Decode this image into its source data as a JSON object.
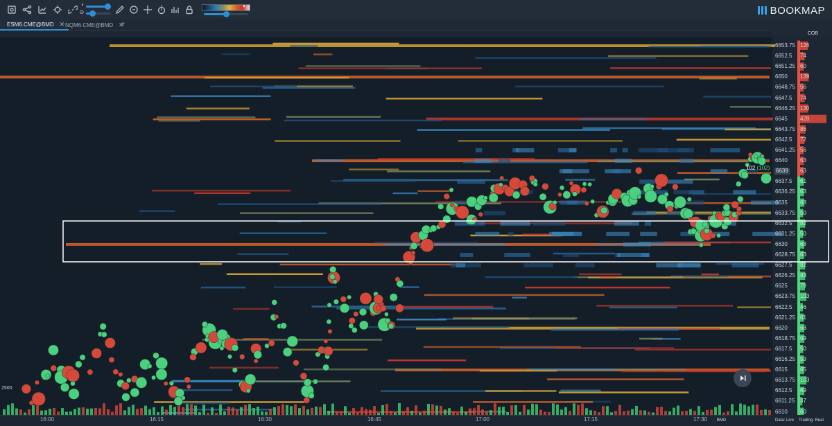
{
  "app": {
    "brand": "BOOKMAP",
    "colors": {
      "background": "#1c2733",
      "accent": "#2e8fd6",
      "ask": "#d8483a",
      "bid": "#3fcf72",
      "highlight_box": "#ffffff"
    }
  },
  "toolbar": {
    "icons": [
      "screenshot-icon",
      "share-icon",
      "chart-icon",
      "crosshair-icon",
      "link-icon",
      "opacity-icon",
      "pencil-icon",
      "chat-icon",
      "move-icon",
      "stopwatch-icon",
      "indicators-icon",
      "lock-icon"
    ],
    "slider_top_level": 0.85,
    "slider_bottom_level": 0.25,
    "heatmap_slider_level": 0.5,
    "dropdown_arrow": "▾"
  },
  "tabs": [
    {
      "label": "ESM6.CME@BMD",
      "close": "✕",
      "active": true
    },
    {
      "label": "NQM6.CME@BMD",
      "close": "✕",
      "active": false
    }
  ],
  "add_tab": "+",
  "cob_header": "COB",
  "price_levels": [
    {
      "price": "6653.75",
      "cob": "126",
      "side": "ask"
    },
    {
      "price": "6652.5",
      "cob": "74",
      "side": "ask"
    },
    {
      "price": "6651.25",
      "cob": "60",
      "side": "ask"
    },
    {
      "price": "6650",
      "cob": "139",
      "side": "ask"
    },
    {
      "price": "6648.75",
      "cob": "56",
      "side": "ask"
    },
    {
      "price": "6647.5",
      "cob": "74",
      "side": "ask"
    },
    {
      "price": "6646.25",
      "cob": "130",
      "side": "ask"
    },
    {
      "price": "6645",
      "cob": "428",
      "side": "ask"
    },
    {
      "price": "6643.75",
      "cob": "86",
      "side": "ask"
    },
    {
      "price": "6642.5",
      "cob": "72",
      "side": "ask"
    },
    {
      "price": "6641.25",
      "cob": "56",
      "side": "ask"
    },
    {
      "price": "6640",
      "cob": "63",
      "side": "ask"
    },
    {
      "price": "6639",
      "cob": "63",
      "side": "ask"
    },
    {
      "price": "6637.5",
      "cob": "61",
      "side": "bid"
    },
    {
      "price": "6636.25",
      "cob": "63",
      "side": "bid"
    },
    {
      "price": "6635",
      "cob": "68",
      "side": "bid"
    },
    {
      "price": "6633.75",
      "cob": "50",
      "side": "bid"
    },
    {
      "price": "6632.5",
      "cob": "82",
      "side": "bid"
    },
    {
      "price": "6631.25",
      "cob": "50",
      "side": "bid"
    },
    {
      "price": "6630",
      "cob": "68",
      "side": "bid"
    },
    {
      "price": "6628.75",
      "cob": "63",
      "side": "bid"
    },
    {
      "price": "6627.5",
      "cob": "82",
      "side": "bid"
    },
    {
      "price": "6626.25",
      "cob": "83",
      "side": "bid"
    },
    {
      "price": "6625",
      "cob": "79",
      "side": "bid"
    },
    {
      "price": "6623.75",
      "cob": "103",
      "side": "bid"
    },
    {
      "price": "6622.5",
      "cob": "46",
      "side": "bid"
    },
    {
      "price": "6621.25",
      "cob": "61",
      "side": "bid"
    },
    {
      "price": "6620",
      "cob": "68",
      "side": "bid"
    },
    {
      "price": "6618.75",
      "cob": "69",
      "side": "bid"
    },
    {
      "price": "6617.5",
      "cob": "50",
      "side": "bid"
    },
    {
      "price": "6616.25",
      "cob": "59",
      "side": "bid"
    },
    {
      "price": "6615",
      "cob": "65",
      "side": "bid"
    },
    {
      "price": "6613.75",
      "cob": "103",
      "side": "bid"
    },
    {
      "price": "6612.5",
      "cob": "69",
      "side": "bid"
    },
    {
      "price": "6611.25",
      "cob": "37",
      "side": "bid"
    },
    {
      "price": "6610",
      "cob": "60",
      "side": "bid"
    }
  ],
  "current_price": "6639",
  "last_trade": {
    "size": "102",
    "aggregate": "(102)"
  },
  "time_axis": [
    "16:00",
    "16:15",
    "16:30",
    "16:45",
    "17:00",
    "17:15",
    "17:30"
  ],
  "left_axis_label": "2500",
  "footer": {
    "bmd": "BMD",
    "data_status": "Data: Live",
    "trading_status": "Trading: Real"
  },
  "replay_button": "jump-to-live-icon"
}
